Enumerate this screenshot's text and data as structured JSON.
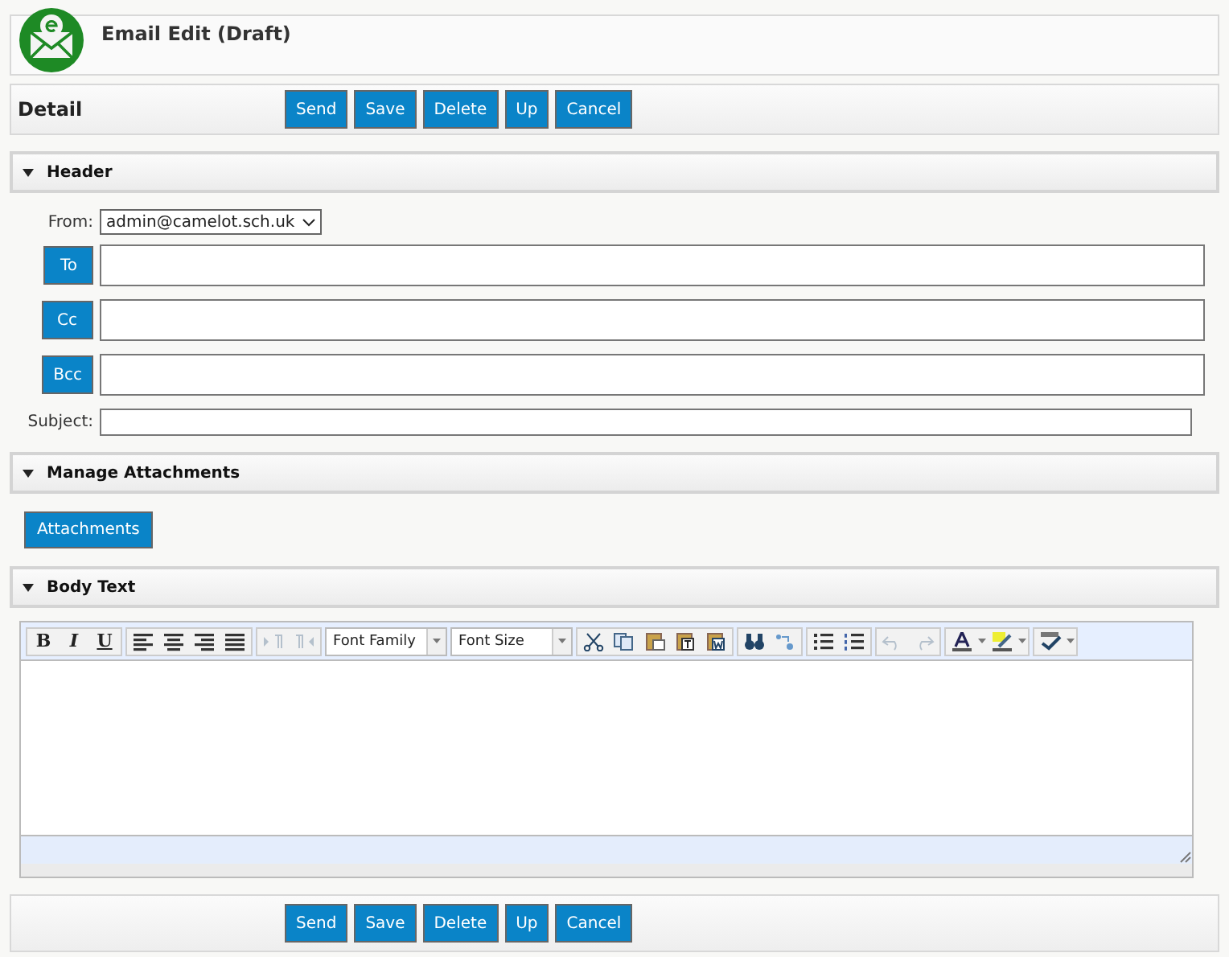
{
  "window": {
    "title": "Email Edit (Draft)"
  },
  "detail_bar": {
    "label": "Detail",
    "buttons": [
      "Send",
      "Save",
      "Delete",
      "Up",
      "Cancel"
    ]
  },
  "header_section": {
    "title": "Header",
    "expanded": true,
    "from": {
      "label": "From:",
      "value": "admin@camelot.sch.uk"
    },
    "recipients": [
      {
        "label": "To"
      },
      {
        "label": "Cc"
      },
      {
        "label": "Bcc"
      }
    ],
    "subject": {
      "label": "Subject:"
    }
  },
  "attachments_section": {
    "title": "Manage Attachments",
    "expanded": true,
    "button": "Attachments"
  },
  "body_section": {
    "title": "Body Text",
    "expanded": true,
    "toolbar": {
      "format_buttons": [
        "B",
        "I",
        "U"
      ],
      "groups": [
        {
          "kind": "align",
          "disabled": false
        },
        {
          "kind": "indent",
          "disabled": true
        },
        {
          "kind": "fontfamily",
          "label": "Font Family",
          "disabled": false
        },
        {
          "kind": "fontsize",
          "label": "Font Size",
          "disabled": false
        },
        {
          "kind": "clipboard",
          "disabled": false
        },
        {
          "kind": "find",
          "disabled": false
        },
        {
          "kind": "lists",
          "disabled": false
        },
        {
          "kind": "history",
          "disabled": true
        },
        {
          "kind": "colors",
          "disabled": false
        },
        {
          "kind": "spelling",
          "disabled": false
        }
      ]
    }
  },
  "footer_bar": {
    "buttons": [
      "Send",
      "Save",
      "Delete",
      "Up",
      "Cancel"
    ]
  }
}
